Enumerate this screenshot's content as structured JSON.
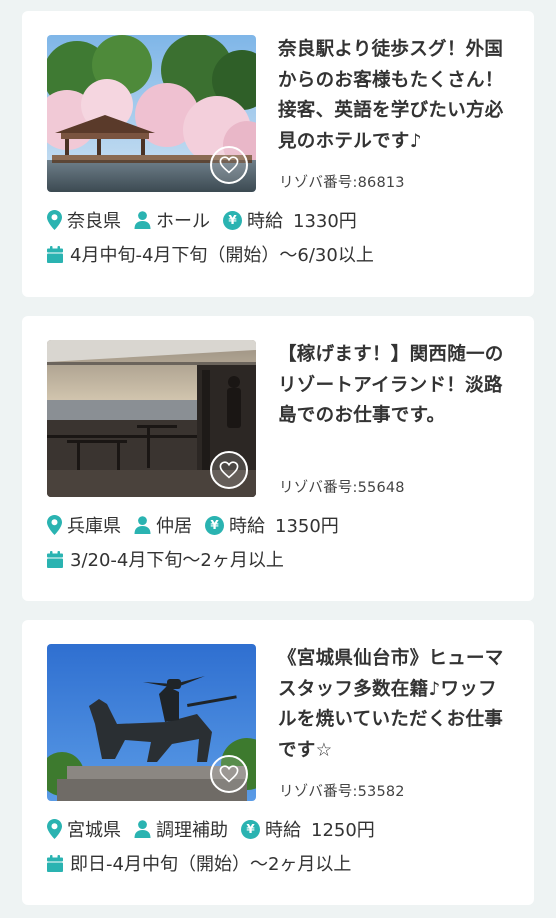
{
  "accent_color": "#2ab3b1",
  "labels": {
    "resort_no": "リゾバ番号:",
    "wage": "時給",
    "yen_symbol": "¥"
  },
  "jobs": [
    {
      "title": "奈良駅より徒歩スグ！外国からのお客様もたくさん！接客、英語を学びたい方必見のホテルです♪",
      "resort_no": "86813",
      "prefecture": "奈良県",
      "position": "ホール",
      "wage": "1330円",
      "period": "4月中旬-4月下旬（開始）〜6/30以上",
      "image": "nara-pavilion-cherry-blossoms"
    },
    {
      "title": "【稼げます！】関西随一のリゾートアイランド！淡路島でのお仕事です。",
      "resort_no": "55648",
      "prefecture": "兵庫県",
      "position": "仲居",
      "wage": "1350円",
      "period": "3/20-4月下旬〜2ヶ月以上",
      "image": "ocean-view-terrace"
    },
    {
      "title": "《宮城県仙台市》ヒューマスタッフ多数在籍♪ワッフルを焼いていただくお仕事です☆",
      "resort_no": "53582",
      "prefecture": "宮城県",
      "position": "調理補助",
      "wage": "1250円",
      "period": "即日-4月中旬（開始）〜2ヶ月以上",
      "image": "date-masamune-statue"
    }
  ]
}
